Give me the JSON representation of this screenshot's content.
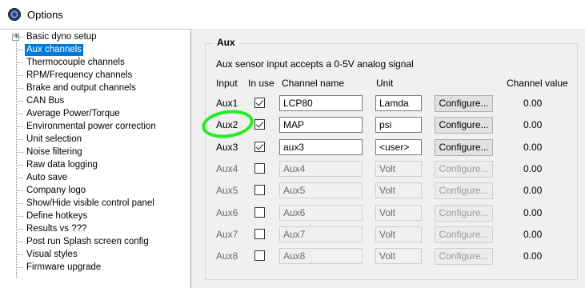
{
  "window": {
    "title": "Options"
  },
  "tree": {
    "items": [
      "Basic dyno setup",
      "Aux channels",
      "Thermocouple channels",
      "RPM/Frequency channels",
      "Brake and output channels",
      "CAN Bus",
      "Average Power/Torque",
      "Environmental power correction",
      "Unit selection",
      "Noise filtering",
      "Raw data logging",
      "Auto save",
      "Company logo",
      "Show/Hide visible control panel",
      "Define hotkeys",
      "Results vs ???",
      "Post run Splash screen config",
      "Visual styles",
      "Firmware upgrade"
    ],
    "selected": "Aux channels",
    "expander_symbol": "+"
  },
  "aux": {
    "group_title": "Aux",
    "description": "Aux  sensor input accepts a 0-5V analog signal",
    "headers": {
      "input": "Input",
      "in_use": "In use",
      "channel_name": "Channel name",
      "unit": "Unit",
      "channel_value": "Channel value"
    },
    "rows": [
      {
        "input": "Aux1",
        "in_use": true,
        "channel_name": "LCP80",
        "unit": "Lamda",
        "button": "Configure...",
        "value": "0.00"
      },
      {
        "input": "Aux2",
        "in_use": true,
        "channel_name": "MAP",
        "unit": "psi",
        "button": "Configure...",
        "value": "0.00"
      },
      {
        "input": "Aux3",
        "in_use": true,
        "channel_name": "aux3",
        "unit": "<user>",
        "button": "Configure...",
        "value": "0.00"
      },
      {
        "input": "Aux4",
        "in_use": false,
        "channel_name": "Aux4",
        "unit": "Volt",
        "button": "Configure...",
        "value": "0.00"
      },
      {
        "input": "Aux5",
        "in_use": false,
        "channel_name": "Aux5",
        "unit": "Volt",
        "button": "Configure...",
        "value": "0.00"
      },
      {
        "input": "Aux6",
        "in_use": false,
        "channel_name": "Aux6",
        "unit": "Volt",
        "button": "Configure...",
        "value": "0.00"
      },
      {
        "input": "Aux7",
        "in_use": false,
        "channel_name": "Aux7",
        "unit": "Volt",
        "button": "Configure...",
        "value": "0.00"
      },
      {
        "input": "Aux8",
        "in_use": false,
        "channel_name": "Aux8",
        "unit": "Volt",
        "button": "Configure...",
        "value": "0.00"
      }
    ]
  },
  "colors": {
    "selection": "#0078d7",
    "annotation": "#22ee22"
  }
}
